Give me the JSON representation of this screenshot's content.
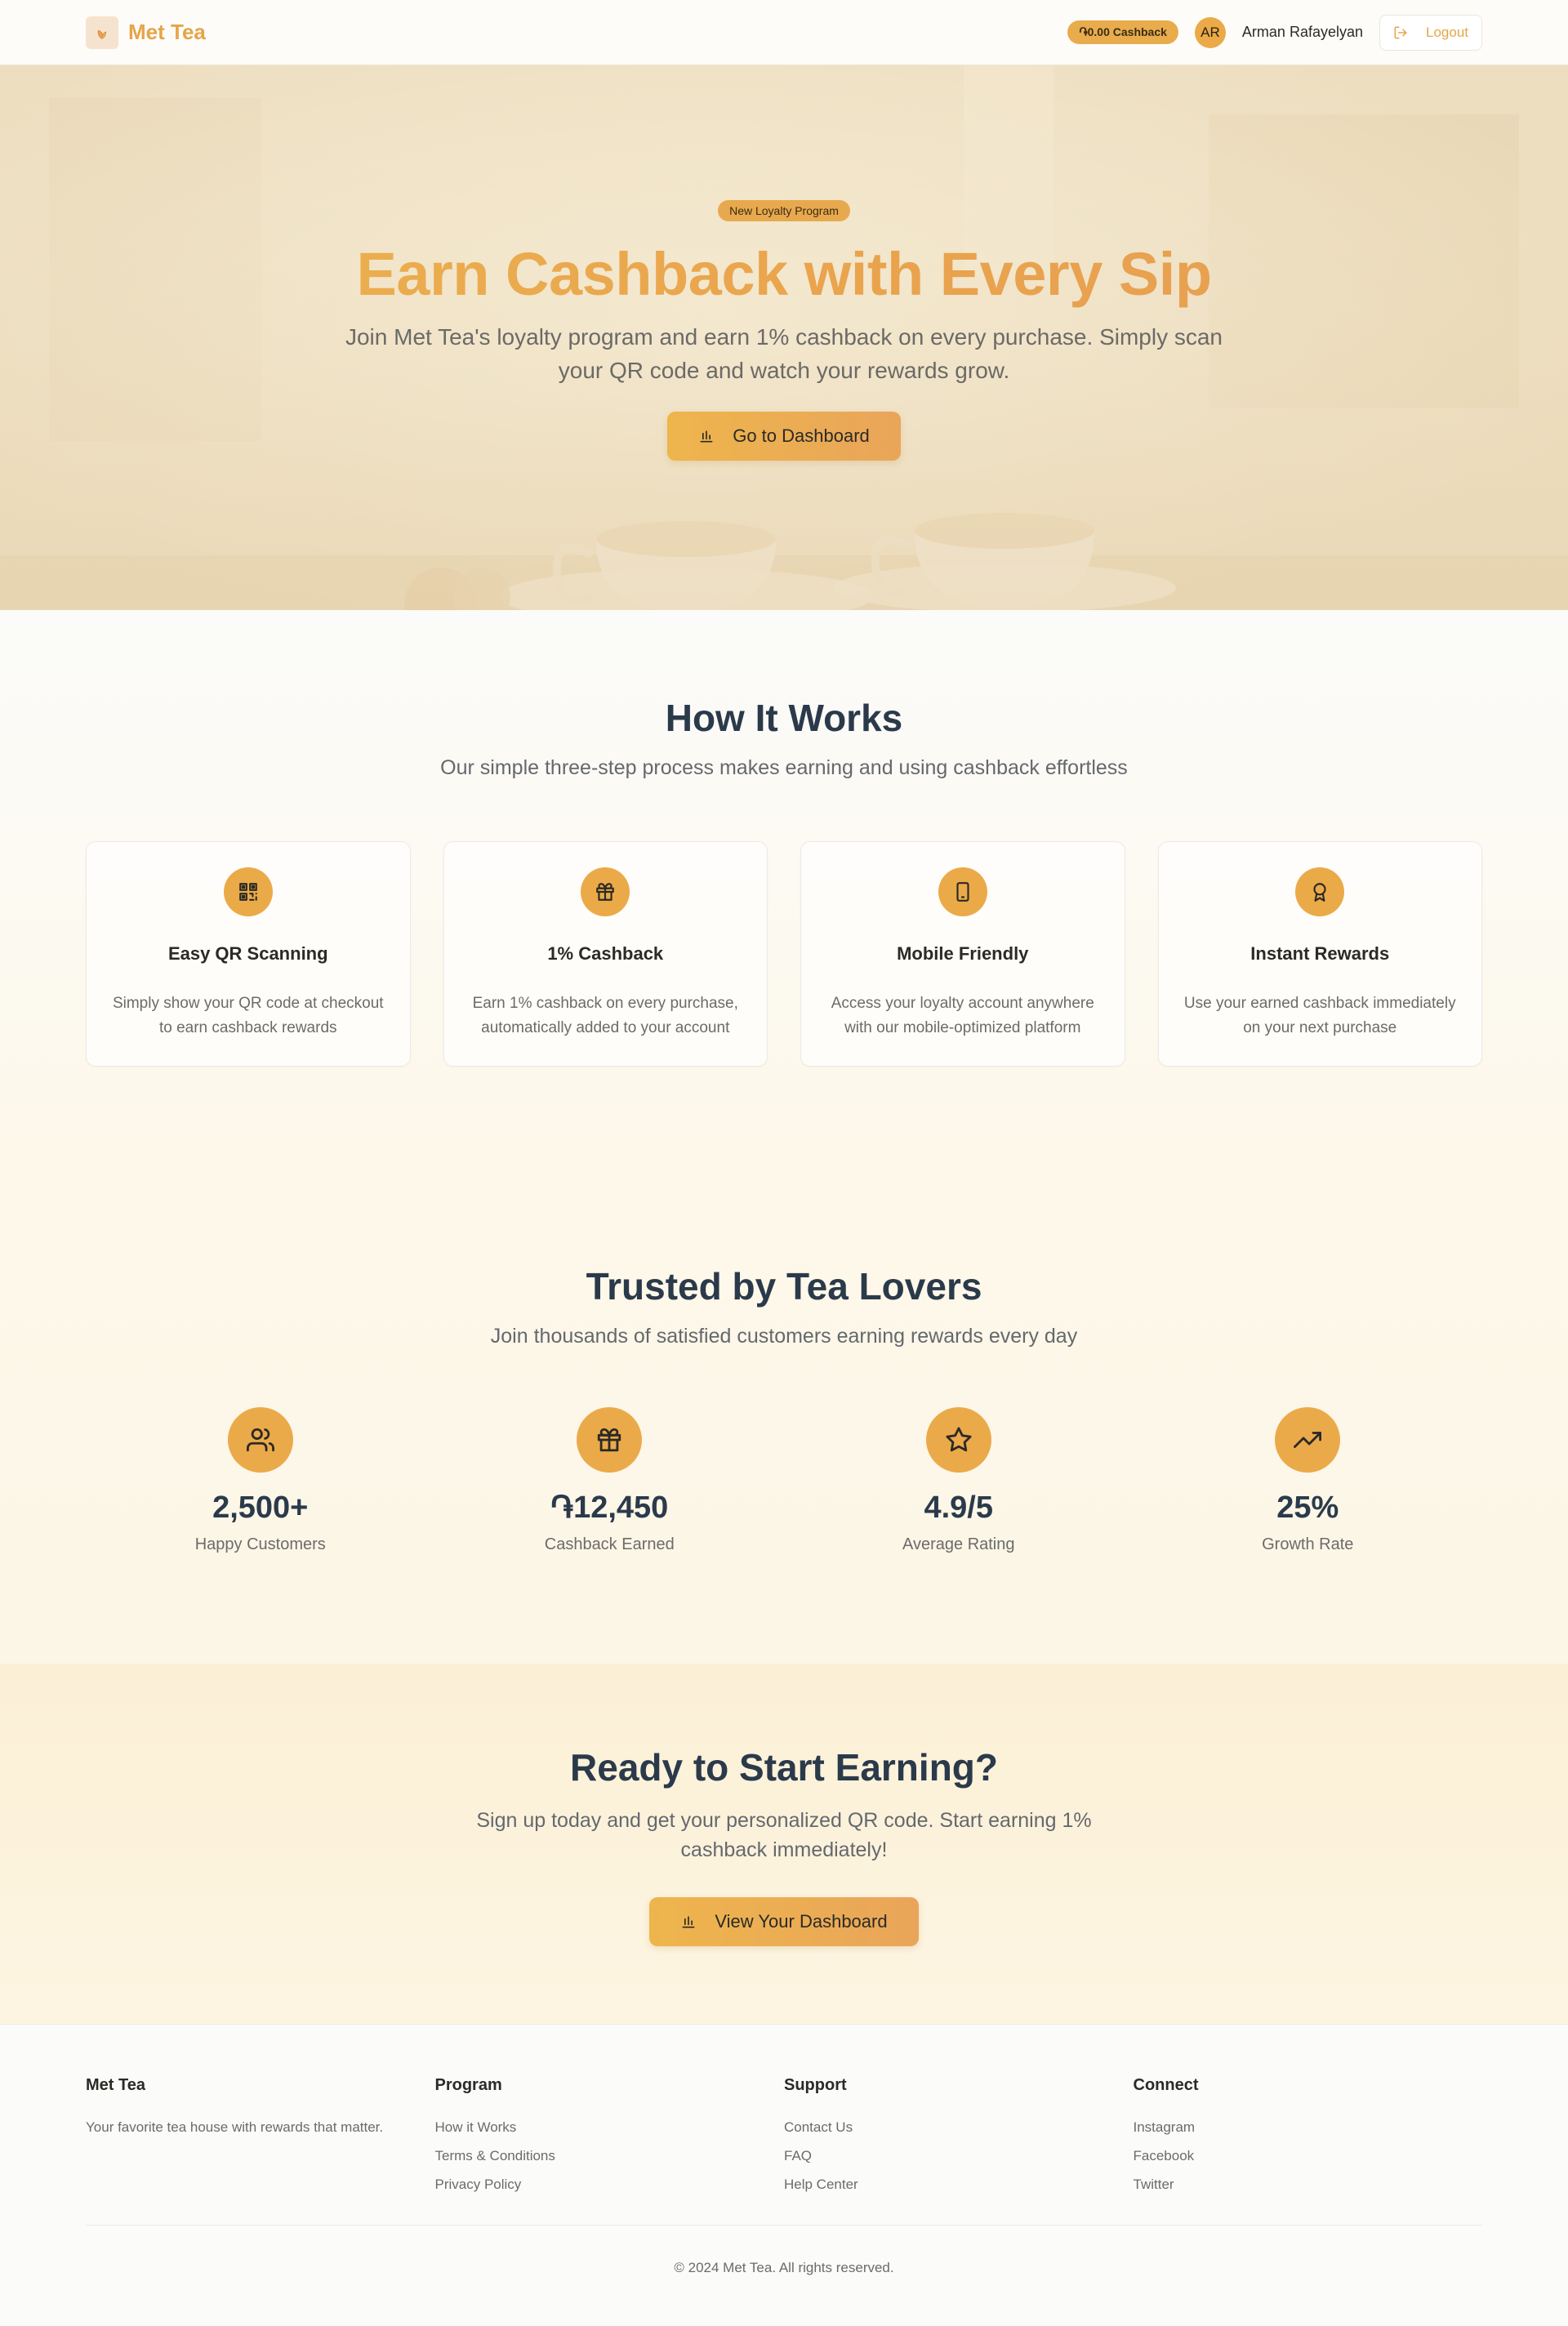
{
  "header": {
    "brand_name": "Met Tea",
    "cashback_badge": "֏0.00 Cashback",
    "avatar_initials": "AR",
    "user_name": "Arman Rafayelyan",
    "logout_label": "Logout"
  },
  "hero": {
    "tag": "New Loyalty Program",
    "title": "Earn Cashback with Every Sip",
    "subtitle": "Join Met Tea's loyalty program and earn 1% cashback on every purchase. Simply scan your QR code and watch your rewards grow.",
    "button_label": "Go to Dashboard"
  },
  "how": {
    "title": "How It Works",
    "subtitle": "Our simple three-step process makes earning and using cashback effortless",
    "cards": [
      {
        "icon": "qr-code-icon",
        "title": "Easy QR Scanning",
        "text": "Simply show your QR code at checkout to earn cashback rewards"
      },
      {
        "icon": "gift-icon",
        "title": "1% Cashback",
        "text": "Earn 1% cashback on every purchase, automatically added to your account"
      },
      {
        "icon": "smartphone-icon",
        "title": "Mobile Friendly",
        "text": "Access your loyalty account anywhere with our mobile-optimized platform"
      },
      {
        "icon": "award-icon",
        "title": "Instant Rewards",
        "text": "Use your earned cashback immediately on your next purchase"
      }
    ]
  },
  "stats": {
    "title": "Trusted by Tea Lovers",
    "subtitle": "Join thousands of satisfied customers earning rewards every day",
    "items": [
      {
        "icon": "users-icon",
        "value": "2,500+",
        "label": "Happy Customers"
      },
      {
        "icon": "gift-icon",
        "value": "֏12,450",
        "label": "Cashback Earned"
      },
      {
        "icon": "star-icon",
        "value": "4.9/5",
        "label": "Average Rating"
      },
      {
        "icon": "trending-up-icon",
        "value": "25%",
        "label": "Growth Rate"
      }
    ]
  },
  "cta": {
    "title": "Ready to Start Earning?",
    "subtitle": "Sign up today and get your personalized QR code. Start earning 1% cashback immediately!",
    "button_label": "View Your Dashboard"
  },
  "footer": {
    "brand": {
      "title": "Met Tea",
      "text": "Your favorite tea house with rewards that matter."
    },
    "program": {
      "title": "Program",
      "links": [
        "How it Works",
        "Terms & Conditions",
        "Privacy Policy"
      ]
    },
    "support": {
      "title": "Support",
      "links": [
        "Contact Us",
        "FAQ",
        "Help Center"
      ]
    },
    "connect": {
      "title": "Connect",
      "links": [
        "Instagram",
        "Facebook",
        "Twitter"
      ]
    },
    "copyright": "© 2024 Met Tea. All rights reserved."
  },
  "colors": {
    "accent": "#EBAA48",
    "heading": "#2B3A4B",
    "body_text": "#6B6B69"
  }
}
